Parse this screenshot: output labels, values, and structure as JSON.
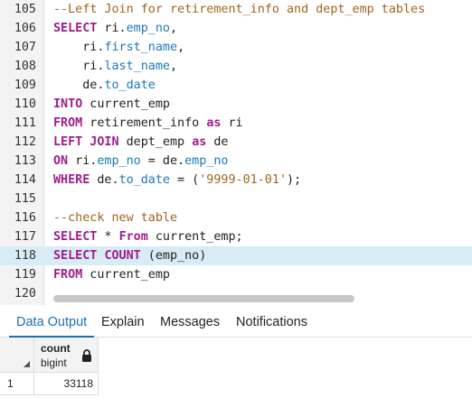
{
  "editor": {
    "lines": [
      {
        "num": "105",
        "tokens": [
          {
            "t": "--Left Join for retirement_info and dept_emp tables",
            "c": "cm"
          }
        ]
      },
      {
        "num": "106",
        "tokens": [
          {
            "t": "SELECT",
            "c": "kw"
          },
          {
            "t": " ri."
          },
          {
            "t": "emp_no",
            "c": "fld"
          },
          {
            "t": ","
          }
        ]
      },
      {
        "num": "107",
        "tokens": [
          {
            "t": "    ri."
          },
          {
            "t": "first_name",
            "c": "fld"
          },
          {
            "t": ","
          }
        ]
      },
      {
        "num": "108",
        "tokens": [
          {
            "t": "    ri."
          },
          {
            "t": "last_name",
            "c": "fld"
          },
          {
            "t": ","
          }
        ]
      },
      {
        "num": "109",
        "tokens": [
          {
            "t": "    de."
          },
          {
            "t": "to_date",
            "c": "fld"
          }
        ]
      },
      {
        "num": "110",
        "tokens": [
          {
            "t": "INTO",
            "c": "kw"
          },
          {
            "t": " current_emp"
          }
        ]
      },
      {
        "num": "111",
        "tokens": [
          {
            "t": "FROM",
            "c": "kw"
          },
          {
            "t": " retirement_info "
          },
          {
            "t": "as",
            "c": "kw"
          },
          {
            "t": " ri"
          }
        ]
      },
      {
        "num": "112",
        "tokens": [
          {
            "t": "LEFT JOIN",
            "c": "kw"
          },
          {
            "t": " dept_emp "
          },
          {
            "t": "as",
            "c": "kw"
          },
          {
            "t": " de"
          }
        ]
      },
      {
        "num": "113",
        "tokens": [
          {
            "t": "ON",
            "c": "kw"
          },
          {
            "t": " ri."
          },
          {
            "t": "emp_no",
            "c": "fld"
          },
          {
            "t": " = de."
          },
          {
            "t": "emp_no",
            "c": "fld"
          }
        ]
      },
      {
        "num": "114",
        "tokens": [
          {
            "t": "WHERE",
            "c": "kw"
          },
          {
            "t": " de."
          },
          {
            "t": "to_date",
            "c": "fld"
          },
          {
            "t": " = ("
          },
          {
            "t": "'9999-01-01'",
            "c": "str"
          },
          {
            "t": ");"
          }
        ]
      },
      {
        "num": "115",
        "tokens": []
      },
      {
        "num": "116",
        "tokens": [
          {
            "t": "--check new table",
            "c": "cm"
          }
        ]
      },
      {
        "num": "117",
        "tokens": [
          {
            "t": "SELECT",
            "c": "kw"
          },
          {
            "t": " * "
          },
          {
            "t": "From",
            "c": "kw"
          },
          {
            "t": " current_emp;"
          }
        ]
      },
      {
        "num": "118",
        "highlight": true,
        "tokens": [
          {
            "t": "SELECT",
            "c": "kw"
          },
          {
            "t": " "
          },
          {
            "t": "COUNT",
            "c": "kw"
          },
          {
            "t": " (emp_no)"
          }
        ]
      },
      {
        "num": "119",
        "tokens": [
          {
            "t": "FROM",
            "c": "kw"
          },
          {
            "t": " current_emp"
          }
        ]
      },
      {
        "num": "120",
        "tokens": []
      }
    ]
  },
  "tabs": [
    {
      "label": "Data Output",
      "active": true
    },
    {
      "label": "Explain",
      "active": false
    },
    {
      "label": "Messages",
      "active": false
    },
    {
      "label": "Notifications",
      "active": false
    }
  ],
  "grid": {
    "column": {
      "name": "count",
      "type": "bigint",
      "icon": "lock-icon"
    },
    "rows": [
      {
        "num": "1",
        "value": "33118"
      }
    ]
  },
  "colors": {
    "keyword": "#a01c8c",
    "comment": "#a0641e",
    "field": "#1a7ab3",
    "highlight": "#d7ecf5",
    "active_tab": "#1a6fb5"
  }
}
